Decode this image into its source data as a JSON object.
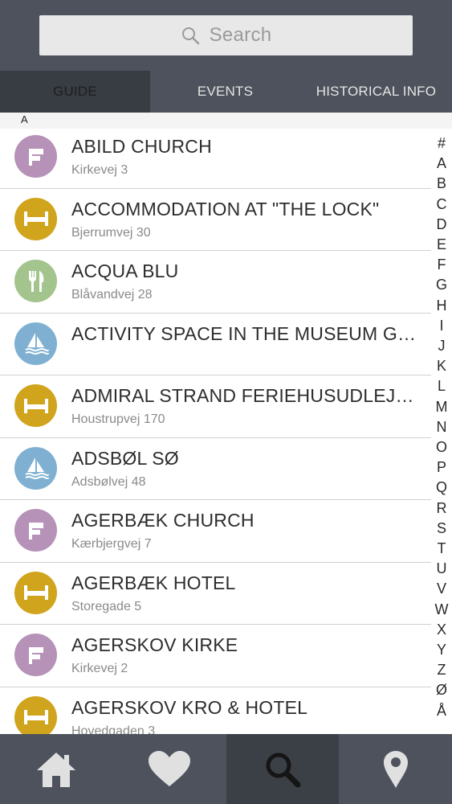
{
  "search": {
    "placeholder": "Search"
  },
  "tabs": [
    {
      "label": "GUIDE",
      "active": true
    },
    {
      "label": "EVENTS",
      "active": false
    },
    {
      "label": "HISTORICAL INFO",
      "active": false
    }
  ],
  "section": {
    "letter": "A"
  },
  "colors": {
    "church": "#b691b8",
    "lodging": "#d0a41c",
    "food": "#a3c48c",
    "activity": "#7fb0d2",
    "bar": "#4d525c"
  },
  "items": [
    {
      "title": "ABILD CHURCH",
      "address": "Kirkevej 3",
      "icon": "church-flag-icon",
      "category": "church"
    },
    {
      "title": "ACCOMMODATION AT \"THE LOCK\"",
      "address": "Bjerrumvej 30",
      "icon": "bed-icon",
      "category": "lodging"
    },
    {
      "title": "ACQUA BLU",
      "address": "Blåvandvej 28",
      "icon": "fork-knife-icon",
      "category": "food"
    },
    {
      "title": "ACTIVITY SPACE IN THE MUSEUM GARDEN",
      "address": "",
      "icon": "sailboat-icon",
      "category": "activity"
    },
    {
      "title": "ADMIRAL STRAND FERIEHUSUDLEJNING",
      "address": "Houstrupvej  170",
      "icon": "bed-icon",
      "category": "lodging"
    },
    {
      "title": "ADSBØL SØ",
      "address": "Adsbølvej 48",
      "icon": "sailboat-icon",
      "category": "activity"
    },
    {
      "title": "AGERBÆK CHURCH",
      "address": "Kærbjergvej 7",
      "icon": "church-flag-icon",
      "category": "church"
    },
    {
      "title": "AGERBÆK HOTEL",
      "address": "Storegade 5",
      "icon": "bed-icon",
      "category": "lodging"
    },
    {
      "title": "AGERSKOV KIRKE",
      "address": "Kirkevej  2",
      "icon": "church-flag-icon",
      "category": "church"
    },
    {
      "title": "AGERSKOV KRO & HOTEL",
      "address": "Hovedgaden 3",
      "icon": "bed-icon",
      "category": "lodging"
    }
  ],
  "alphabet": [
    "#",
    "A",
    "B",
    "C",
    "D",
    "E",
    "F",
    "G",
    "H",
    "I",
    "J",
    "K",
    "L",
    "M",
    "N",
    "O",
    "P",
    "Q",
    "R",
    "S",
    "T",
    "U",
    "V",
    "W",
    "X",
    "Y",
    "Z",
    "Ø",
    "Å"
  ],
  "bottom_nav": [
    {
      "icon": "home-icon",
      "active": false
    },
    {
      "icon": "heart-icon",
      "active": false
    },
    {
      "icon": "search-icon",
      "active": true
    },
    {
      "icon": "location-pin-icon",
      "active": false
    }
  ]
}
